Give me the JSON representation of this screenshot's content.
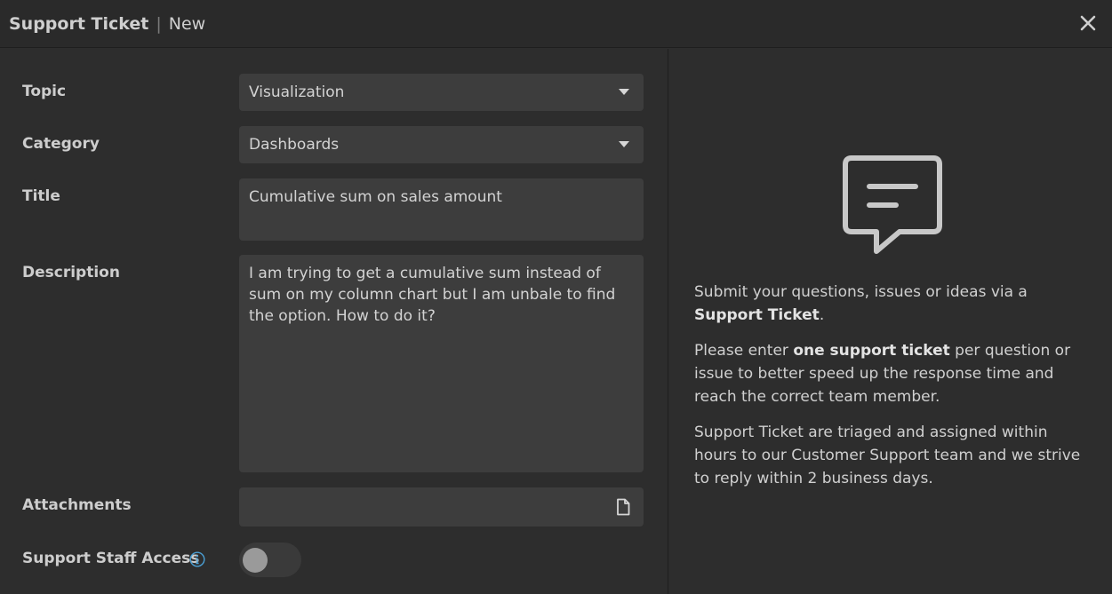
{
  "header": {
    "title": "Support Ticket",
    "separator": "|",
    "state": "New"
  },
  "form": {
    "topic": {
      "label": "Topic",
      "value": "Visualization"
    },
    "category": {
      "label": "Category",
      "value": "Dashboards"
    },
    "title": {
      "label": "Title",
      "value": "Cumulative sum on sales amount"
    },
    "description": {
      "label": "Description",
      "value": "I am trying to get a cumulative sum instead of sum on my column chart but I am unbale to find the option. How to do it?"
    },
    "attachments": {
      "label": "Attachments",
      "value": ""
    },
    "staff_access": {
      "label": "Support Staff Access",
      "enabled": false
    }
  },
  "info": {
    "p1_pre": "Submit your questions, issues or ideas via a ",
    "p1_bold": "Support Ticket",
    "p1_post": ".",
    "p2_pre": "Please enter ",
    "p2_bold": "one support ticket",
    "p2_post": " per question or issue to better speed up the response time and reach the correct team member.",
    "p3": "Support Ticket are triaged and assigned within hours to our Customer Support team and we strive to reply within 2 business days."
  },
  "icons": {
    "close": "close-icon",
    "caret": "chevron-down-icon",
    "file": "file-icon",
    "info": "info-icon",
    "chat": "chat-bubble-icon"
  },
  "colors": {
    "background": "#2d2d2d",
    "field": "#3d3d3d",
    "text": "#d6d6d6",
    "info_accent": "#4a9fd4"
  }
}
